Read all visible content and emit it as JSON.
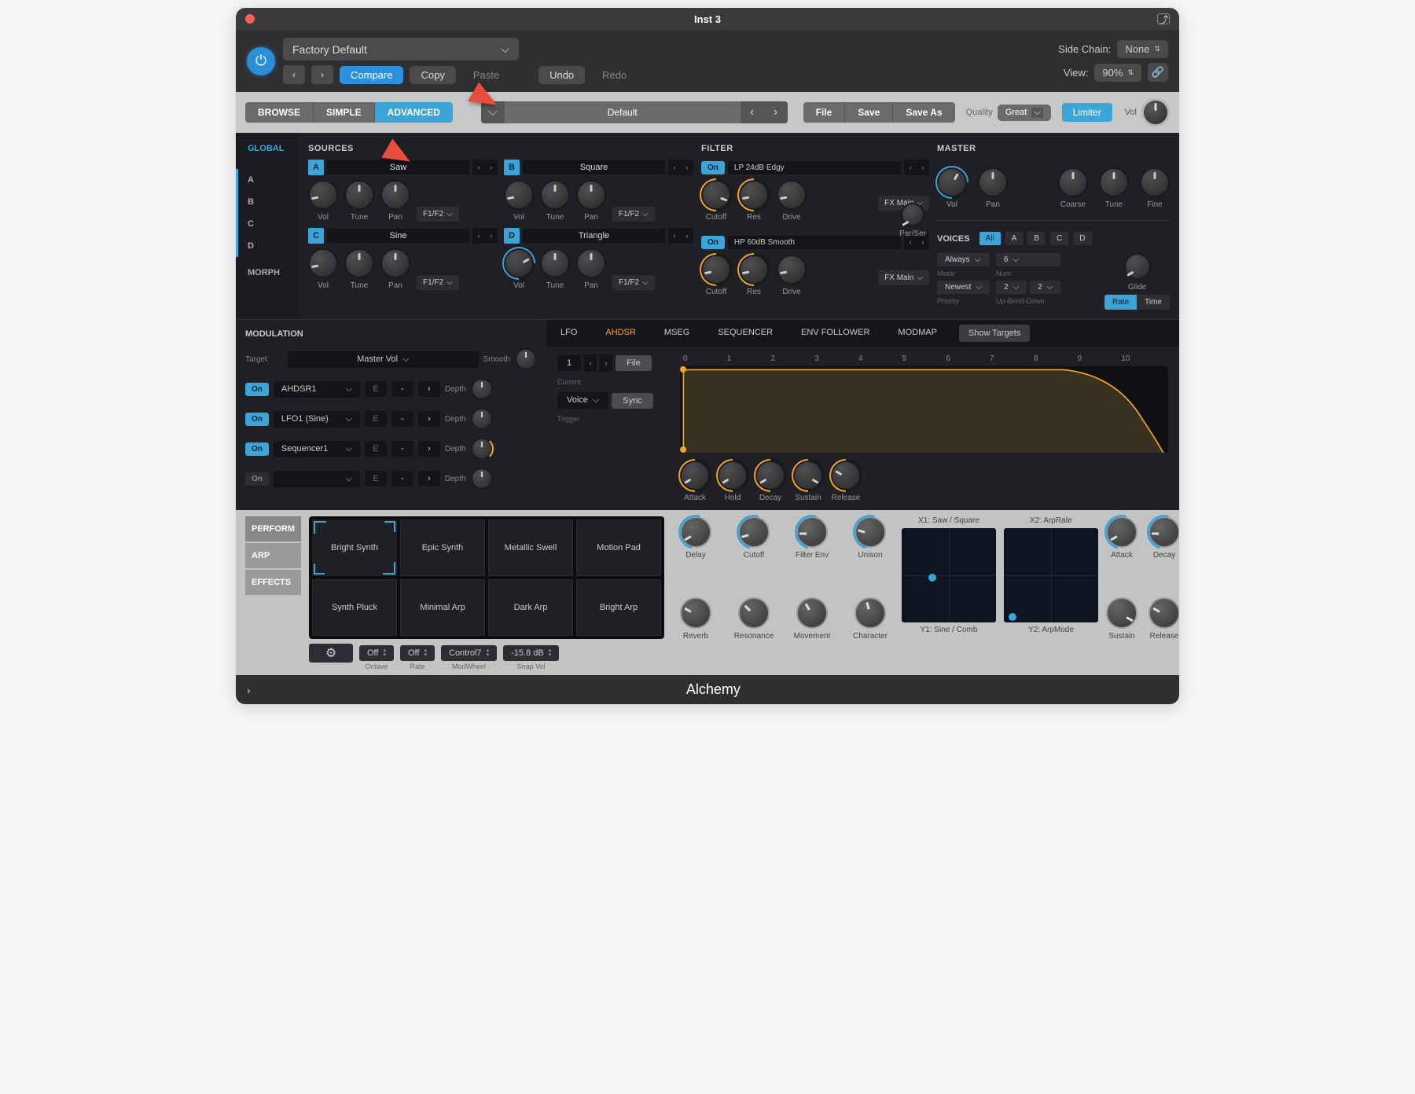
{
  "window": {
    "title": "Inst 3"
  },
  "header": {
    "preset": "Factory Default",
    "compare": "Compare",
    "copy": "Copy",
    "paste": "Paste",
    "undo": "Undo",
    "redo": "Redo",
    "sidechain_label": "Side Chain:",
    "sidechain_value": "None",
    "view_label": "View:",
    "view_value": "90%"
  },
  "toolbar": {
    "browse": "BROWSE",
    "simple": "SIMPLE",
    "advanced": "ADVANCED",
    "preset_name": "Default",
    "file": "File",
    "save": "Save",
    "saveas": "Save As",
    "quality_label": "Quality",
    "quality_value": "Great",
    "limiter": "Limiter",
    "vol": "Vol"
  },
  "left_tabs": {
    "global": "GLOBAL",
    "a": "A",
    "b": "B",
    "c": "C",
    "d": "D",
    "morph": "MORPH"
  },
  "sources": {
    "title": "SOURCES",
    "a": {
      "name": "Saw"
    },
    "b": {
      "name": "Square"
    },
    "c": {
      "name": "Sine"
    },
    "d": {
      "name": "Triangle"
    },
    "knobs": {
      "vol": "Vol",
      "tune": "Tune",
      "pan": "Pan",
      "route": "F1/F2"
    }
  },
  "filter": {
    "title": "FILTER",
    "f1": {
      "on": "On",
      "name": "LP 24dB Edgy"
    },
    "f2": {
      "on": "On",
      "name": "HP 60dB Smooth"
    },
    "knobs": {
      "cutoff": "Cutoff",
      "res": "Res",
      "drive": "Drive",
      "fx": "FX Main",
      "parser": "Par/Ser"
    }
  },
  "master": {
    "title": "MASTER",
    "vol": "Vol",
    "pan": "Pan",
    "coarse": "Coarse",
    "tune": "Tune",
    "fine": "Fine"
  },
  "voices": {
    "title": "VOICES",
    "all": "All",
    "mode": "Always",
    "mode_label": "Mode",
    "num": "6",
    "num_label": "Num",
    "priority": "Newest",
    "priority_label": "Priority",
    "up": "2",
    "down": "2",
    "bend_label": "Up-Bend-Down",
    "glide": "Glide",
    "rate": "Rate",
    "time": "Time"
  },
  "modulation": {
    "title": "MODULATION",
    "target_label": "Target",
    "target": "Master Vol",
    "smooth": "Smooth",
    "rows": [
      {
        "on": "On",
        "src": "AHDSR1",
        "e": "E",
        "depth": "Depth"
      },
      {
        "on": "On",
        "src": "LFO1 (Sine)",
        "e": "E",
        "depth": "Depth"
      },
      {
        "on": "On",
        "src": "Sequencer1",
        "e": "E",
        "depth": "Depth"
      },
      {
        "on": "On",
        "src": "",
        "e": "E",
        "depth": "Depth"
      }
    ],
    "tabs": {
      "lfo": "LFO",
      "ahdsr": "AHDSR",
      "mseg": "MSEG",
      "seq": "SEQUENCER",
      "env": "ENV FOLLOWER",
      "modmap": "MODMAP"
    },
    "show_targets": "Show Targets",
    "current": "1",
    "current_label": "Current",
    "file": "File",
    "trigger": "Voice",
    "trigger_label": "Trigger",
    "sync": "Sync",
    "ruler": [
      "0",
      "1",
      "2",
      "3",
      "4",
      "5",
      "6",
      "7",
      "8",
      "9",
      "10"
    ],
    "env_knobs": {
      "attack": "Attack",
      "hold": "Hold",
      "decay": "Decay",
      "sustain": "Sustain",
      "release": "Release"
    }
  },
  "perform": {
    "tabs": {
      "perform": "PERFORM",
      "arp": "ARP",
      "effects": "EFFECTS"
    },
    "pads": [
      "Bright Synth",
      "Epic Synth",
      "Metallic Swell",
      "Motion Pad",
      "Synth Pluck",
      "Minimal Arp",
      "Dark Arp",
      "Bright Arp"
    ],
    "controls": {
      "octave": "Off",
      "octave_label": "Octave",
      "rate": "Off",
      "rate_label": "Rate",
      "modwheel": "Control7",
      "modwheel_label": "ModWheel",
      "snapvol": "-15.8 dB",
      "snapvol_label": "Snap Vol"
    },
    "knobs": [
      "Delay",
      "Cutoff",
      "Filter Env",
      "Unison",
      "Reverb",
      "Resonance",
      "Movement",
      "Character"
    ],
    "xy": {
      "x1": "X1: Saw / Square",
      "y1": "Y1: Sine / Comb",
      "x2": "X2: ArpRate",
      "y2": "Y2: ArpMode"
    },
    "adsr": {
      "attack": "Attack",
      "decay": "Decay",
      "sustain": "Sustain",
      "release": "Release"
    }
  },
  "footer": {
    "title": "Alchemy"
  }
}
